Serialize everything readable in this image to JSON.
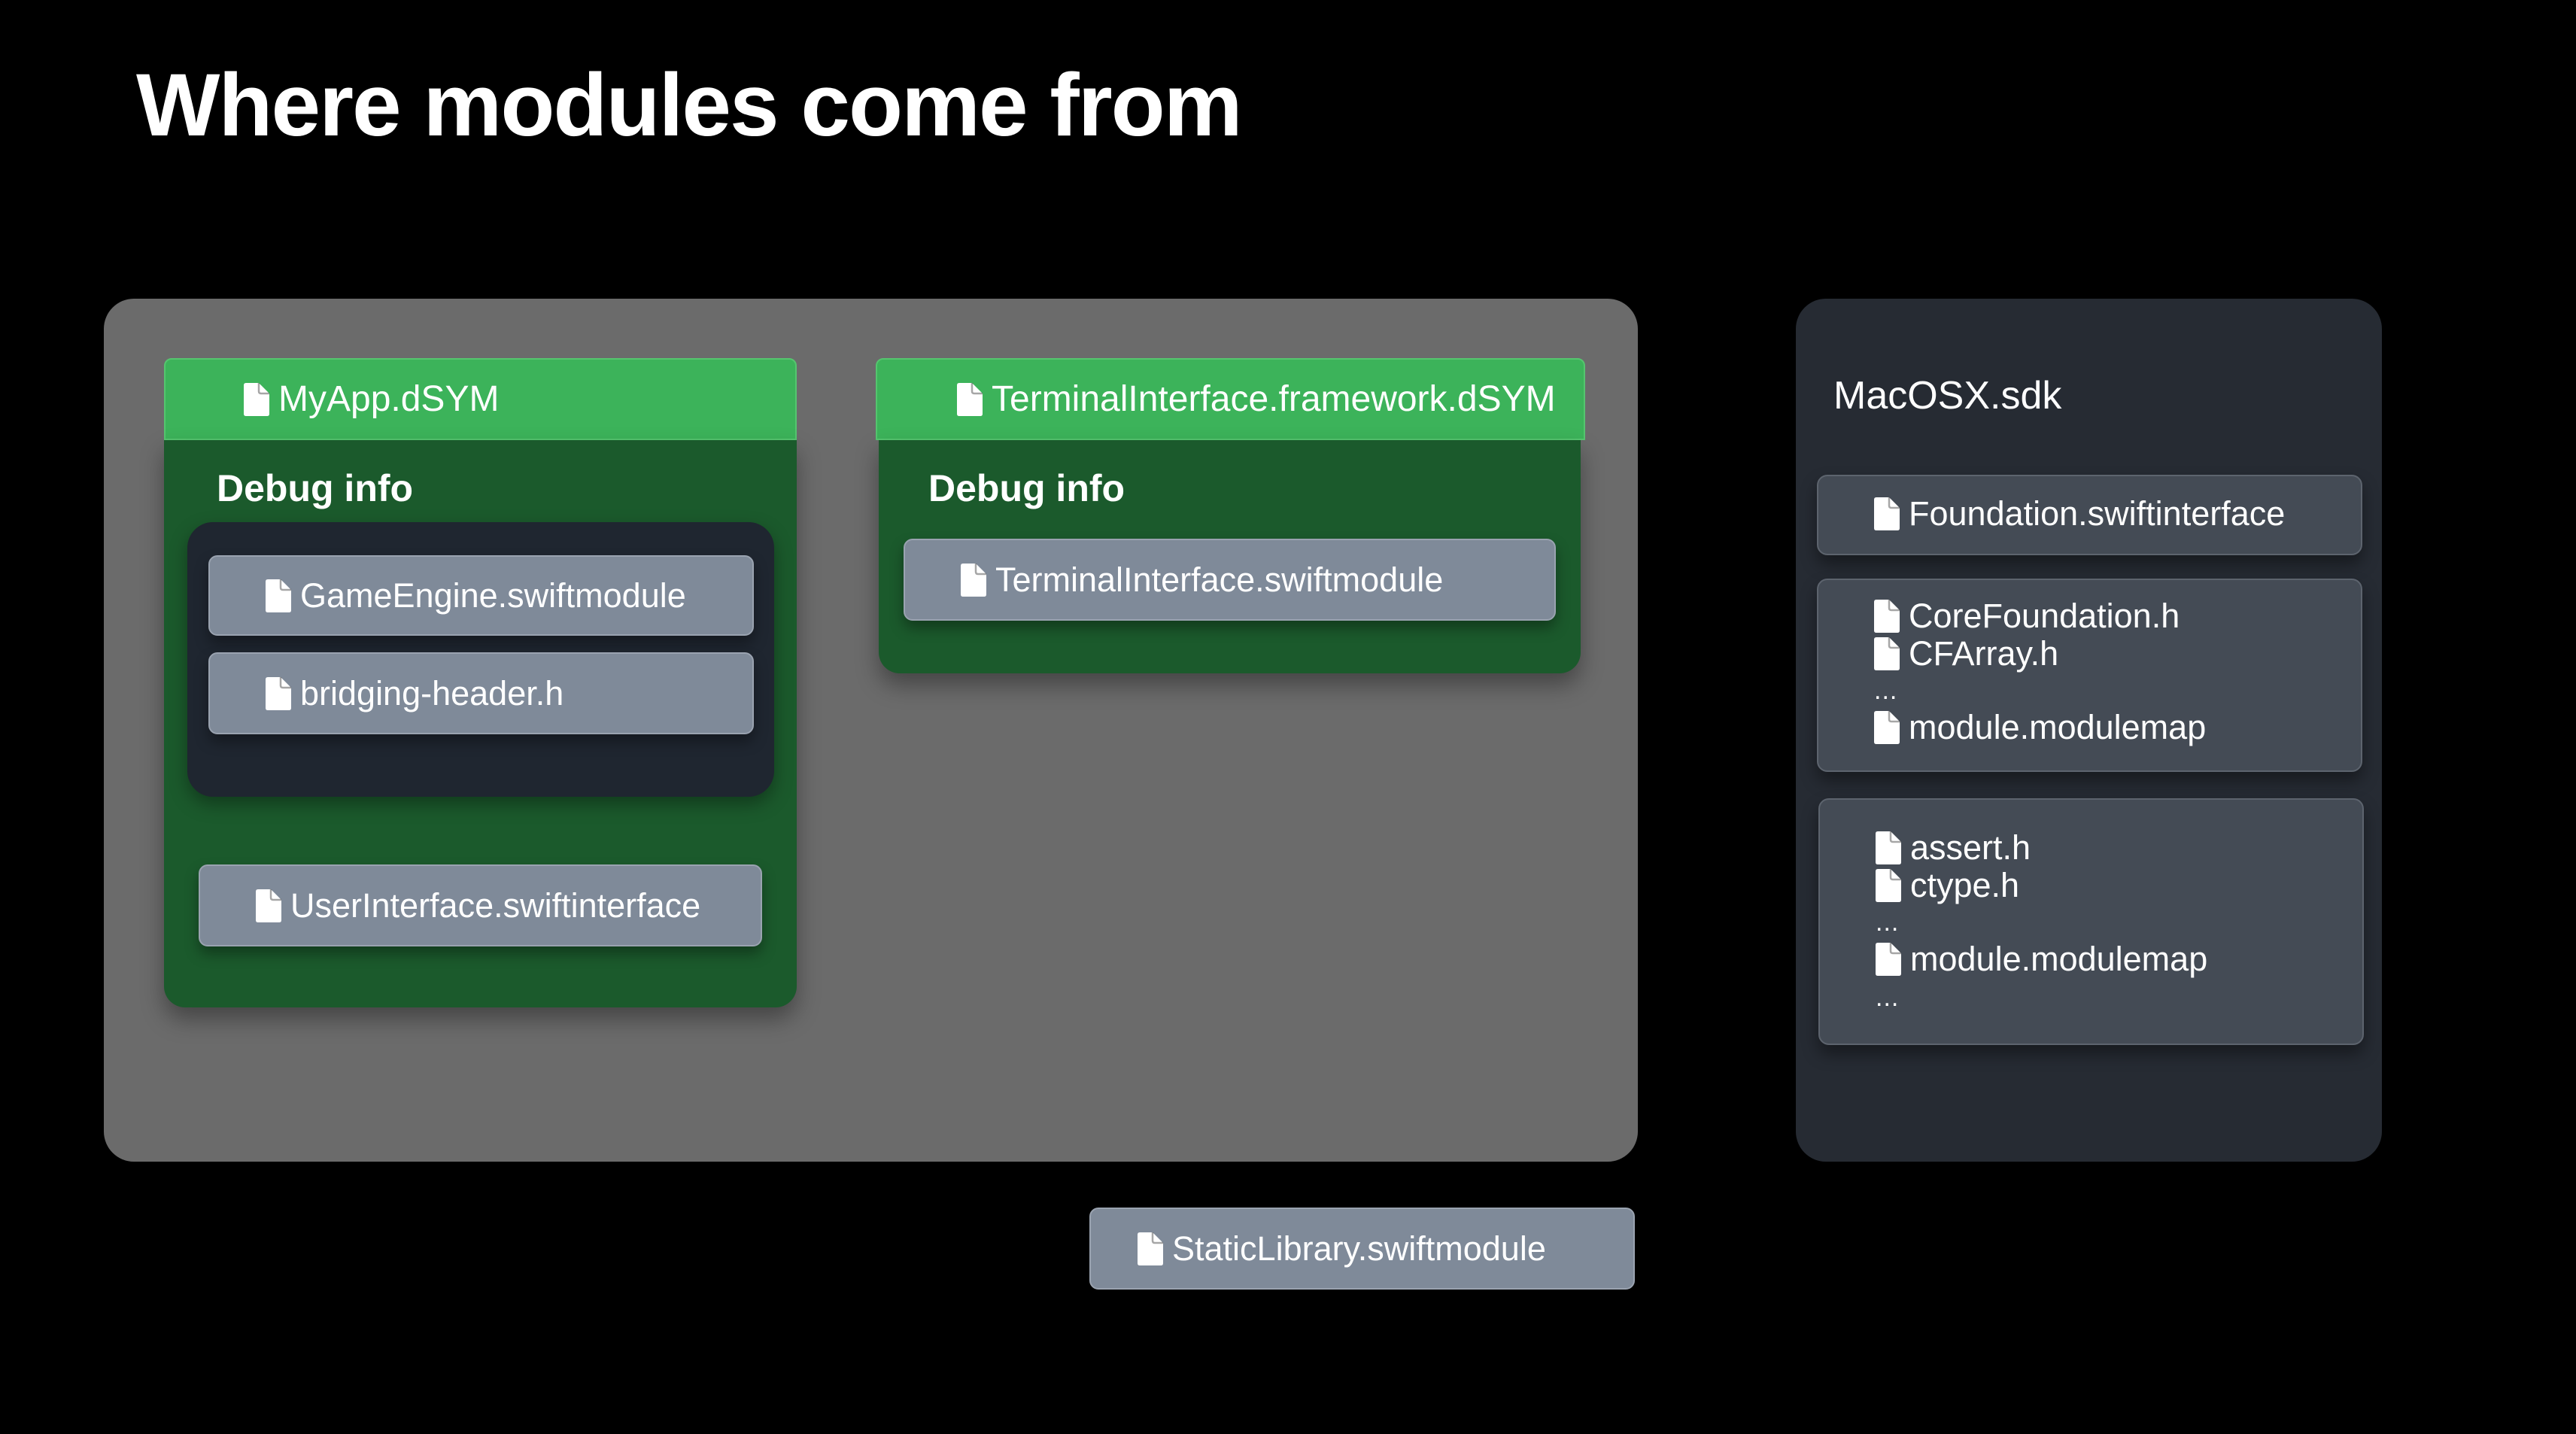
{
  "slide": {
    "title": "Where modules come from"
  },
  "build_products": {
    "myapp_dsym": {
      "header_label": "MyApp.dSYM",
      "section_label": "Debug info",
      "debug_info_items": [
        "GameEngine.swiftmodule",
        "bridging-header.h"
      ],
      "extra_item": "UserInterface.swiftinterface"
    },
    "terminal_dsym": {
      "header_label": "TerminalInterface.framework.dSYM",
      "section_label": "Debug info",
      "debug_info_items": [
        "TerminalInterface.swiftmodule"
      ]
    }
  },
  "standalone_item": "StaticLibrary.swiftmodule",
  "sdk": {
    "title": "MacOSX.sdk",
    "foundation": "Foundation.swiftinterface",
    "corefoundation_group": {
      "files": [
        "CoreFoundation.h",
        "CFArray.h"
      ],
      "ellipsis": "...",
      "modulemap": "module.modulemap"
    },
    "libc_group": {
      "files": [
        "assert.h",
        "ctype.h"
      ],
      "ellipsis": "...",
      "modulemap": "module.modulemap",
      "trailing_ellipsis": "..."
    }
  },
  "colors": {
    "background": "#000000",
    "build_panel": "#6b6b6b",
    "dsym_header": "#3cb35a",
    "dsym_body": "#1b5a2c",
    "debug_inner": "#1f2630",
    "file_item": "#7f8a99",
    "sdk_panel": "#262b33",
    "sdk_box": "#444b55"
  }
}
